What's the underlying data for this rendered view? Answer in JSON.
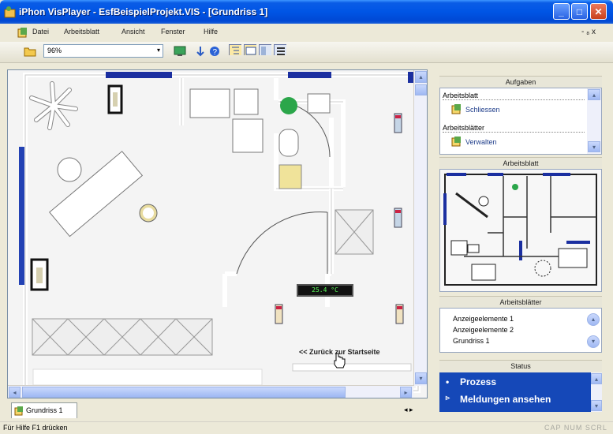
{
  "window": {
    "title": "iPhon VisPlayer - EsfBeispielProjekt.VIS - [Grundriss 1]",
    "min": "_",
    "max": "□",
    "close": "✕"
  },
  "menubar": {
    "items": [
      "Datei",
      "Arbeitsblatt",
      "Ansicht",
      "Fenster",
      "Hilfe"
    ],
    "right_controls": "- ₈ x"
  },
  "toolbar": {
    "zoom_value": "96%"
  },
  "canvas": {
    "temperature": "25.4 °C",
    "back_link": "<< Zurück zur Startseite"
  },
  "tabs": {
    "sheet_tab": "Grundriss 1",
    "nav_arrows": "◂ ▸"
  },
  "statusbar": {
    "help": "Für Hilfe F1 drücken",
    "indicators": "CAP  NUM  SCRL"
  },
  "sidepanel": {
    "tasks": {
      "header": "Aufgaben",
      "group1": "Arbeitsblatt",
      "item1": "Schliessen",
      "group2": "Arbeitsblätter",
      "item2": "Verwalten"
    },
    "preview": {
      "header": "Arbeitsblatt"
    },
    "sheets": {
      "header": "Arbeitsblätter",
      "items": [
        "Anzeigeelemente 1",
        "Anzeigeelemente 2",
        "Grundriss 1"
      ]
    },
    "status": {
      "header": "Status",
      "items": [
        "Prozess",
        "Meldungen ansehen"
      ]
    }
  }
}
